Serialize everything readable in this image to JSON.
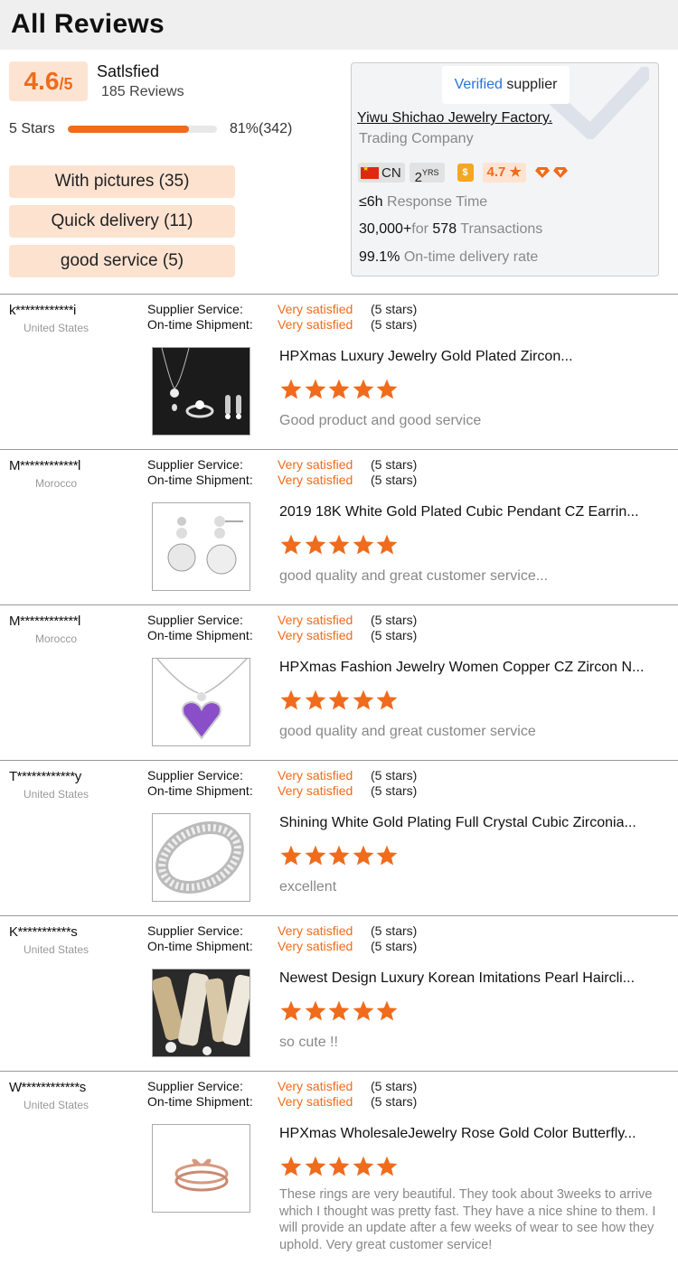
{
  "page_title": "All Reviews",
  "summary": {
    "score": "4.6",
    "score_max": "/5",
    "satisfaction_label": "Satlsfied",
    "review_count": "185 Reviews",
    "five_star_label": "5 Stars",
    "five_star_fraction": 0.81,
    "five_star_pct_text": "81%(342)"
  },
  "tags": [
    {
      "label": "With pictures  (35)"
    },
    {
      "label": "Quick delivery (11)"
    },
    {
      "label": "good service (5)"
    }
  ],
  "supplier": {
    "verified_prefix": "V",
    "verified_rest": "erified",
    "verified_suffix": " supplier",
    "company_name": "Yiwu Shichao Jewelry Factory.",
    "company_type": "Trading Company",
    "country": "CN",
    "years": "2",
    "years_unit": "YRS",
    "gold_icon": "$",
    "rating": "4.7 ★",
    "response_value": "≤6h",
    "response_label": " Response Time",
    "transactions_amount": "30,000+",
    "transactions_for": "for ",
    "transactions_count": "578",
    "transactions_label": " Transactions",
    "ontime_rate": "99.1%",
    "ontime_label": " On-time delivery rate",
    "accent_color": "#f06b1b"
  },
  "review_labels": {
    "supplier_service": "Supplier Service:",
    "ontime_shipment": "On-time Shipment:"
  },
  "reviews": [
    {
      "name": "k************i",
      "country": "United States",
      "service_sat": "Very satisfied",
      "service_stars": "(5 stars)",
      "shipment_sat": "Very satisfied",
      "shipment_stars": "(5 stars)",
      "product_title": "HPXmas Luxury Jewelry Gold Plated Zircon...",
      "rating": 5,
      "text": "Good product and good service",
      "image": "jewelry-set-image"
    },
    {
      "name": "M************l",
      "country": "Morocco",
      "service_sat": "Very satisfied",
      "service_stars": "(5 stars)",
      "shipment_sat": "Very satisfied",
      "shipment_stars": "(5 stars)",
      "product_title": "2019 18K White Gold Plated Cubic Pendant CZ Earrin...",
      "rating": 5,
      "text": "good quality and great customer service...",
      "image": "earrings-image"
    },
    {
      "name": "M************l",
      "country": "Morocco",
      "service_sat": "Very satisfied",
      "service_stars": "(5 stars)",
      "shipment_sat": "Very satisfied",
      "shipment_stars": "(5 stars)",
      "product_title": "HPXmas Fashion Jewelry Women Copper CZ Zircon N...",
      "rating": 5,
      "text": "good quality and great customer service",
      "image": "purple-heart-necklace-image"
    },
    {
      "name": "T************y",
      "country": "United States",
      "service_sat": "Very satisfied",
      "service_stars": "(5 stars)",
      "shipment_sat": "Very satisfied",
      "shipment_stars": "(5 stars)",
      "product_title": "Shining White Gold Plating Full Crystal Cubic Zirconia...",
      "rating": 5,
      "text": "excellent",
      "image": "crystal-ring-image"
    },
    {
      "name": "K***********s",
      "country": "United States",
      "service_sat": "Very satisfied",
      "service_stars": "(5 stars)",
      "shipment_sat": "Very satisfied",
      "shipment_stars": "(5 stars)",
      "product_title": "Newest Design Luxury Korean Imitations Pearl Haircli...",
      "rating": 5,
      "text": "so cute !!",
      "image": "pearl-hairclips-image"
    },
    {
      "name": "W************s",
      "country": "United States",
      "service_sat": "Very satisfied",
      "service_stars": "(5 stars)",
      "shipment_sat": "Very satisfied",
      "shipment_stars": "(5 stars)",
      "product_title": "HPXmas WholesaleJewelry Rose Gold Color Butterfly...",
      "rating": 5,
      "text": "These rings are very beautiful. They took about 3weeks to arrive which I thought was pretty fast. They have a nice shine to them. I will provide an update after a few weeks of wear to see how they uphold. Very great customer service!",
      "image": "butterfly-ring-image"
    }
  ]
}
